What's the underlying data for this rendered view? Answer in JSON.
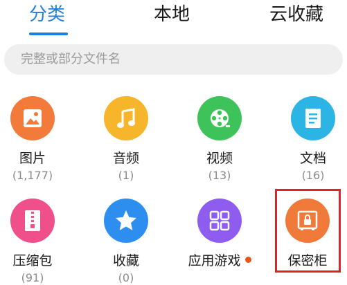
{
  "tabs": [
    {
      "label": "分类",
      "active": true
    },
    {
      "label": "本地",
      "active": false
    },
    {
      "label": "云收藏",
      "active": false
    }
  ],
  "search": {
    "placeholder": "完整或部分文件名"
  },
  "categories": [
    {
      "label": "图片",
      "count": "(1,177)",
      "icon": "image-icon",
      "color": "#f27b3c"
    },
    {
      "label": "音频",
      "count": "(1)",
      "icon": "music-note-icon",
      "color": "#f7b52b"
    },
    {
      "label": "视频",
      "count": "(13)",
      "icon": "film-reel-icon",
      "color": "#3ec25a"
    },
    {
      "label": "文档",
      "count": "(16)",
      "icon": "document-icon",
      "color": "#2cb4e4"
    },
    {
      "label": "压缩包",
      "count": "(91)",
      "icon": "zip-icon",
      "color": "#ef4f8b"
    },
    {
      "label": "收藏",
      "count": "(0)",
      "icon": "star-icon",
      "color": "#2e8ef0"
    },
    {
      "label": "应用游戏",
      "count": "",
      "icon": "apps-grid-icon",
      "color": "#8f5cf0",
      "badge_color": "#e8541e"
    },
    {
      "label": "保密柜",
      "count": "",
      "icon": "safe-lock-icon",
      "color": "#f07a3a"
    }
  ],
  "highlight_color": "#d9262b",
  "accent_color": "#1f7fd9"
}
